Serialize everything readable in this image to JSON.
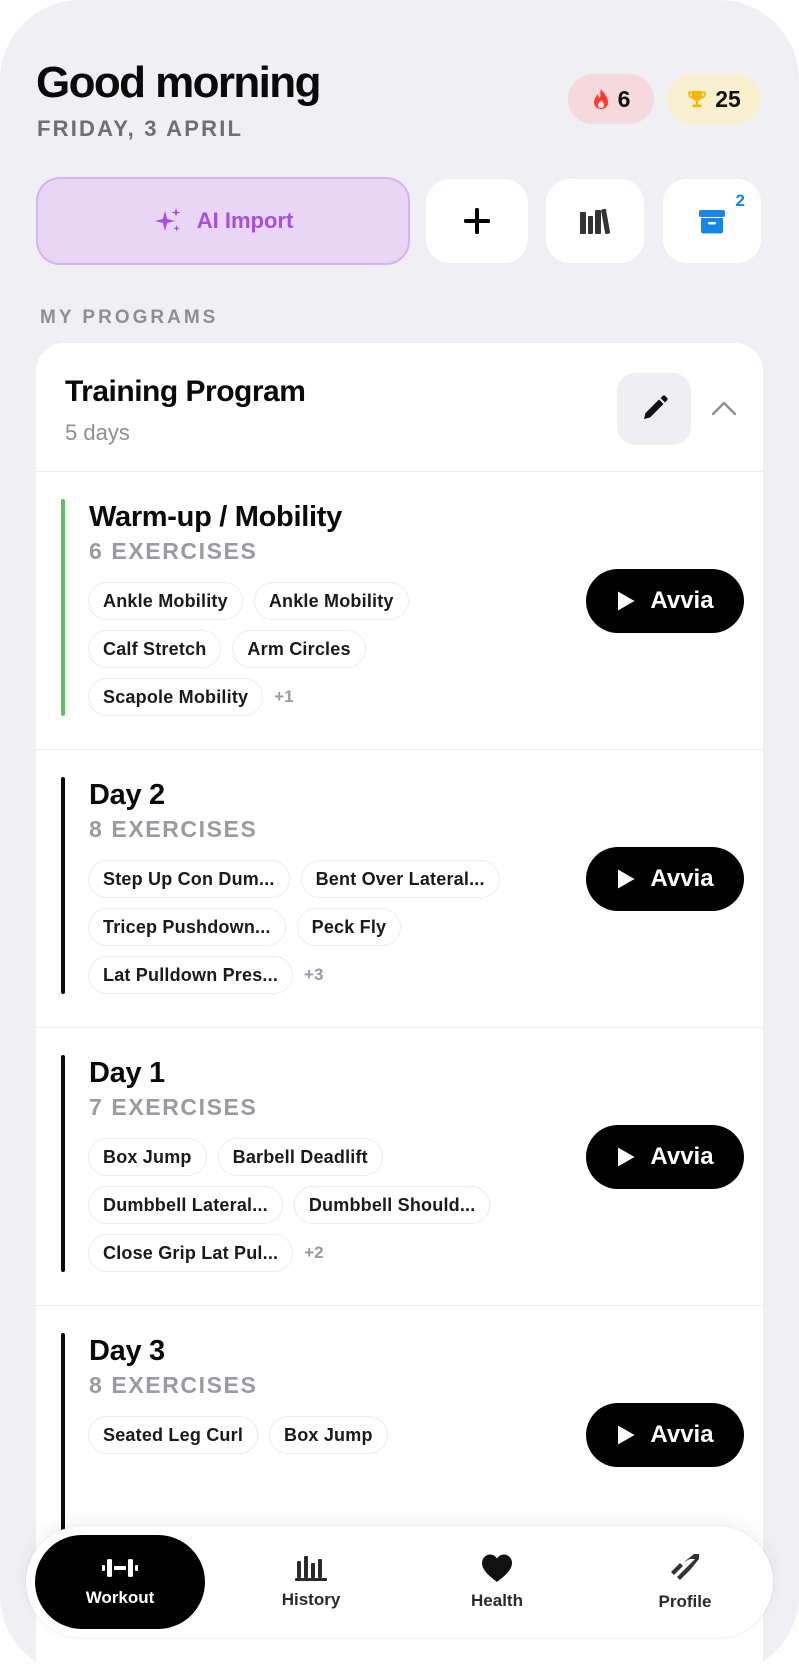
{
  "header": {
    "greeting": "Good morning",
    "date": "FRIDAY, 3 APRIL",
    "streak": {
      "icon": "flame-icon",
      "value": "6",
      "color": "#ff3b30"
    },
    "trophies": {
      "icon": "trophy-icon",
      "value": "25",
      "color": "#f5b800"
    }
  },
  "actions": {
    "ai_import_label": "AI Import",
    "ai_import_color": "#a64fe0",
    "archive_badge": "2"
  },
  "section_label": "MY PROGRAMS",
  "program": {
    "title": "Training Program",
    "subtitle": "5 days",
    "days": [
      {
        "title": "Warm-up / Mobility",
        "count": "6 EXERCISES",
        "accent": "#5ec05f",
        "tag_rows": [
          [
            "Ankle Mobility",
            "Ankle Mobility"
          ],
          [
            "Calf Stretch",
            "Arm Circles"
          ],
          [
            "Scapole Mobility"
          ]
        ],
        "more": "+1",
        "start_label": "Avvia"
      },
      {
        "title": "Day 2",
        "count": "8 EXERCISES",
        "accent": "#0a0a0a",
        "tag_rows": [
          [
            "Step Up Con Dum...",
            "Bent Over Lateral..."
          ],
          [
            "Tricep Pushdown...",
            "Peck Fly"
          ],
          [
            "Lat Pulldown Pres..."
          ]
        ],
        "more": "+3",
        "start_label": "Avvia"
      },
      {
        "title": "Day 1",
        "count": "7 EXERCISES",
        "accent": "#0a0a0a",
        "tag_rows": [
          [
            "Box Jump",
            "Barbell Deadlift"
          ],
          [
            "Dumbbell Lateral...",
            "Dumbbell Should..."
          ],
          [
            "Close Grip Lat Pul..."
          ]
        ],
        "more": "+2",
        "start_label": "Avvia"
      },
      {
        "title": "Day 3",
        "count": "8 EXERCISES",
        "accent": "#0a0a0a",
        "tag_rows": [
          [
            "Seated Leg Curl",
            "Box Jump"
          ]
        ],
        "more": "",
        "start_label": "Avvia"
      }
    ]
  },
  "tabbar": {
    "workout": "Workout",
    "history": "History",
    "health": "Health",
    "profile": "Profile"
  }
}
